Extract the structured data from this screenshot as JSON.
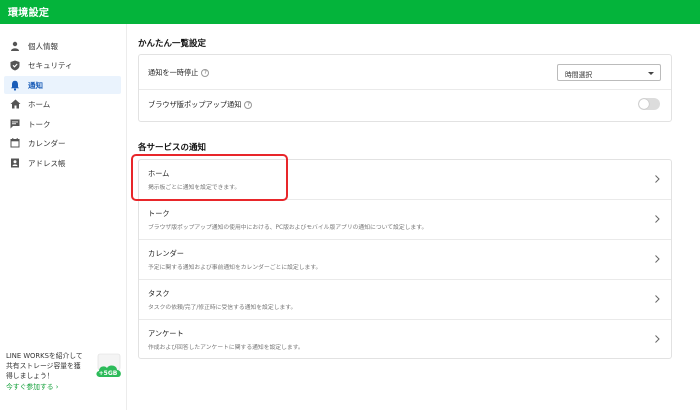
{
  "app": {
    "title": "環境設定"
  },
  "sidebar": {
    "items": [
      {
        "label": "個人情報",
        "icon": "person-icon",
        "active": false
      },
      {
        "label": "セキュリティ",
        "icon": "shield-icon",
        "active": false
      },
      {
        "label": "通知",
        "icon": "bell-icon",
        "active": true
      },
      {
        "label": "ホーム",
        "icon": "home-icon",
        "active": false
      },
      {
        "label": "トーク",
        "icon": "chat-icon",
        "active": false
      },
      {
        "label": "カレンダー",
        "icon": "calendar-icon",
        "active": false
      },
      {
        "label": "アドレス帳",
        "icon": "contacts-icon",
        "active": false
      }
    ],
    "promo": {
      "text": "LINE WORKSを紹介して共有ストレージ容量を獲得しましょう！",
      "link": "今すぐ参加する ›",
      "badge": "+5GB"
    }
  },
  "main": {
    "summary": {
      "title": "かんたん一覧設定",
      "pause": {
        "label": "通知を一時停止",
        "select_value": "時間選択"
      },
      "browser_popup": {
        "label": "ブラウザ版ポップアップ通知",
        "enabled": false
      }
    },
    "services": {
      "title": "各サービスの通知",
      "items": [
        {
          "name": "ホーム",
          "desc": "掲示板ごとに通知を設定できます。"
        },
        {
          "name": "トーク",
          "desc": "ブラウザ版ポップアップ通知の使用中における、PC版およびモバイル版アプリの通知について設定します。"
        },
        {
          "name": "カレンダー",
          "desc": "予定に関する通知および事前通知をカレンダーごとに設定します。"
        },
        {
          "name": "タスク",
          "desc": "タスクの依頼/完了/修正時に受信する通知を設定します。"
        },
        {
          "name": "アンケート",
          "desc": "作成および回答したアンケートに関する通知を設定します。"
        }
      ]
    }
  },
  "colors": {
    "brand": "#04b43b",
    "active_bg": "#eaf3fd",
    "highlight": "#e8262a"
  }
}
